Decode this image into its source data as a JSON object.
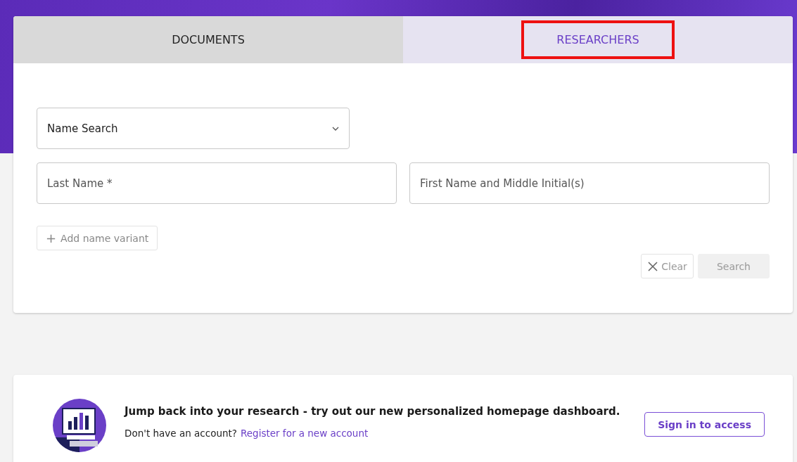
{
  "tabs": [
    {
      "label": "DOCUMENTS",
      "selected": false,
      "highlighted": false
    },
    {
      "label": "RESEARCHERS",
      "selected": true,
      "highlighted": true
    }
  ],
  "search_type": {
    "value": "Name Search"
  },
  "fields": [
    {
      "placeholder": "Last Name *"
    },
    {
      "placeholder": "First Name and Middle Initial(s)"
    }
  ],
  "add_variant": {
    "icon": "+",
    "label": "Add name variant"
  },
  "buttons": [
    {
      "kind": "clear",
      "label": "Clear",
      "disabled": true
    },
    {
      "kind": "search",
      "label": "Search",
      "disabled": true
    }
  ],
  "banner": {
    "headline": "Jump back into your research - try out our new personalized homepage dashboard.",
    "prompt": "Don't have an account?",
    "link": "Register for a new account",
    "button": "Sign in to access"
  }
}
